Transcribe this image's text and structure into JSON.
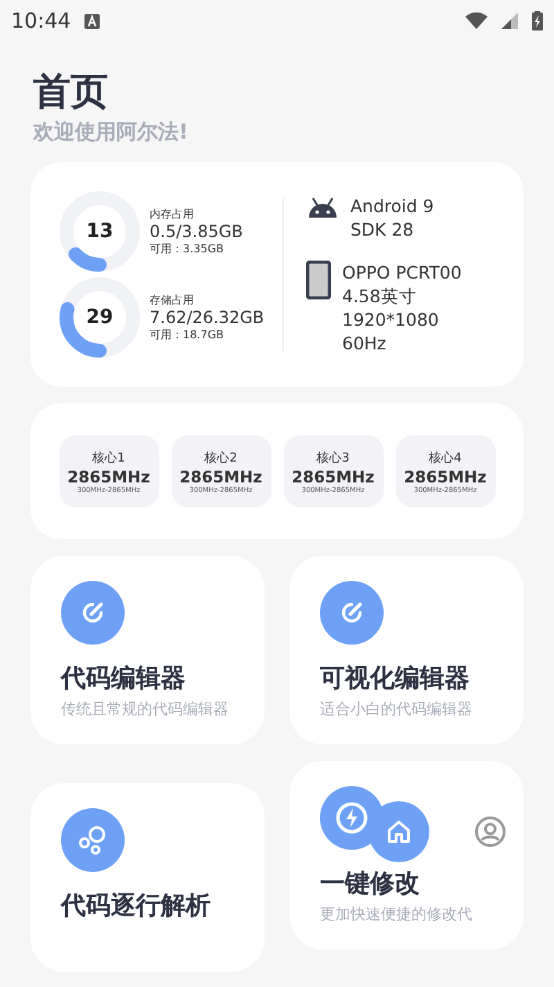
{
  "status_bar": {
    "time": "10:44"
  },
  "header": {
    "title": "首页",
    "subtitle": "欢迎使用阿尔法!"
  },
  "usage": [
    {
      "label": "内存占用",
      "percent": "13",
      "level": 0.13,
      "amount": "0.5/3.85GB",
      "available": "可用：3.35GB"
    },
    {
      "label": "存储占用",
      "percent": "29",
      "level": 0.29,
      "amount": "7.62/26.32GB",
      "available": "可用：18.7GB"
    }
  ],
  "device": [
    {
      "kind": "android",
      "lines": [
        "Android 9",
        "SDK 28"
      ]
    },
    {
      "kind": "phone",
      "lines": [
        "OPPO PCRT00",
        "4.58英寸",
        "1920*1080",
        "60Hz"
      ]
    }
  ],
  "cores": [
    {
      "name": "核心1",
      "freq": "2865MHz",
      "range": "300MHz-2865MHz"
    },
    {
      "name": "核心2",
      "freq": "2865MHz",
      "range": "300MHz-2865MHz"
    },
    {
      "name": "核心3",
      "freq": "2865MHz",
      "range": "300MHz-2865MHz"
    },
    {
      "name": "核心4",
      "freq": "2865MHz",
      "range": "300MHz-2865MHz"
    }
  ],
  "features": [
    {
      "kind": "edit",
      "title": "代码编辑器",
      "description": "传统且常规的代码编辑器"
    },
    {
      "kind": "bubbles",
      "title": "代码逐行解析"
    },
    {
      "kind": "edit",
      "title": "可视化编辑器",
      "description": "适合小白的代码编辑器"
    },
    {
      "kind": "bolt",
      "title": "一键修改",
      "description": "更加快速便捷的修改代"
    }
  ],
  "floating_nav": [
    {
      "kind": "home",
      "selected": true
    },
    {
      "kind": "profile",
      "selected": false
    }
  ]
}
